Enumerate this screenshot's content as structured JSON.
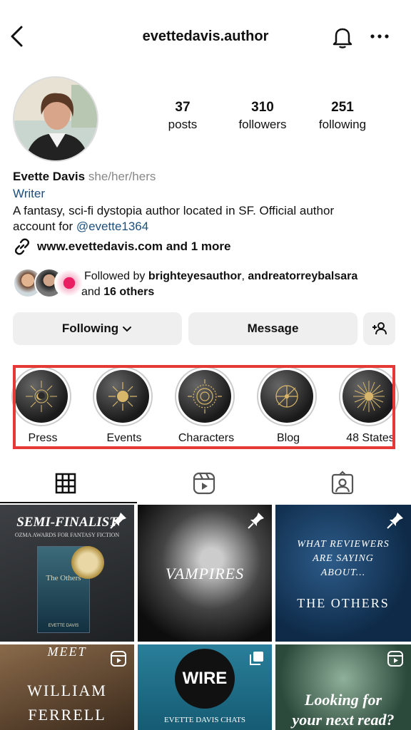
{
  "header": {
    "username": "evettedavis.author"
  },
  "stats": [
    {
      "value": "37",
      "label": "posts"
    },
    {
      "value": "310",
      "label": "followers"
    },
    {
      "value": "251",
      "label": "following"
    }
  ],
  "profile": {
    "name": "Evette Davis",
    "pronouns": "she/her/hers",
    "category": "Writer",
    "bio_line1": "A fantasy, sci-fi dystopia author located in SF. Official author",
    "bio_line2_prefix": "account for ",
    "bio_mention": "@evette1364",
    "link_text": "www.evettedavis.com and 1 more"
  },
  "followed_by": {
    "prefix": "Followed by ",
    "user1": "brighteyesauthor",
    "sep": ", ",
    "user2": "andreatorreybalsara",
    "and": " and ",
    "others": "16 others"
  },
  "buttons": {
    "following": "Following",
    "message": "Message"
  },
  "highlights": [
    {
      "label": "Press"
    },
    {
      "label": "Events"
    },
    {
      "label": "Characters"
    },
    {
      "label": "Blog"
    },
    {
      "label": "48 States"
    }
  ],
  "posts": {
    "p1_title": "SEMI-FINALIST",
    "p1_sub": "OZMA AWARDS FOR FANTASY FICTION",
    "p1_book": "The Others",
    "p1_author": "EVETTE DAVIS",
    "p2_title": "VAMPIRES",
    "p3_line1": "WHAT REVIEWERS",
    "p3_line2": "ARE SAYING",
    "p3_line3": "ABOUT...",
    "p3_line4": "THE OTHERS",
    "p4_line1": "MEET",
    "p4_line2": "WILLIAM",
    "p4_line3": "FERRELL",
    "p5_logo": "WIRE",
    "p5_line1": "EVETTE DAVIS CHATS",
    "p6_line1": "Looking for",
    "p6_line2": "your next read?"
  },
  "colors": {
    "accent_link": "#1c4f7d",
    "highlight_box": "#e53935"
  }
}
